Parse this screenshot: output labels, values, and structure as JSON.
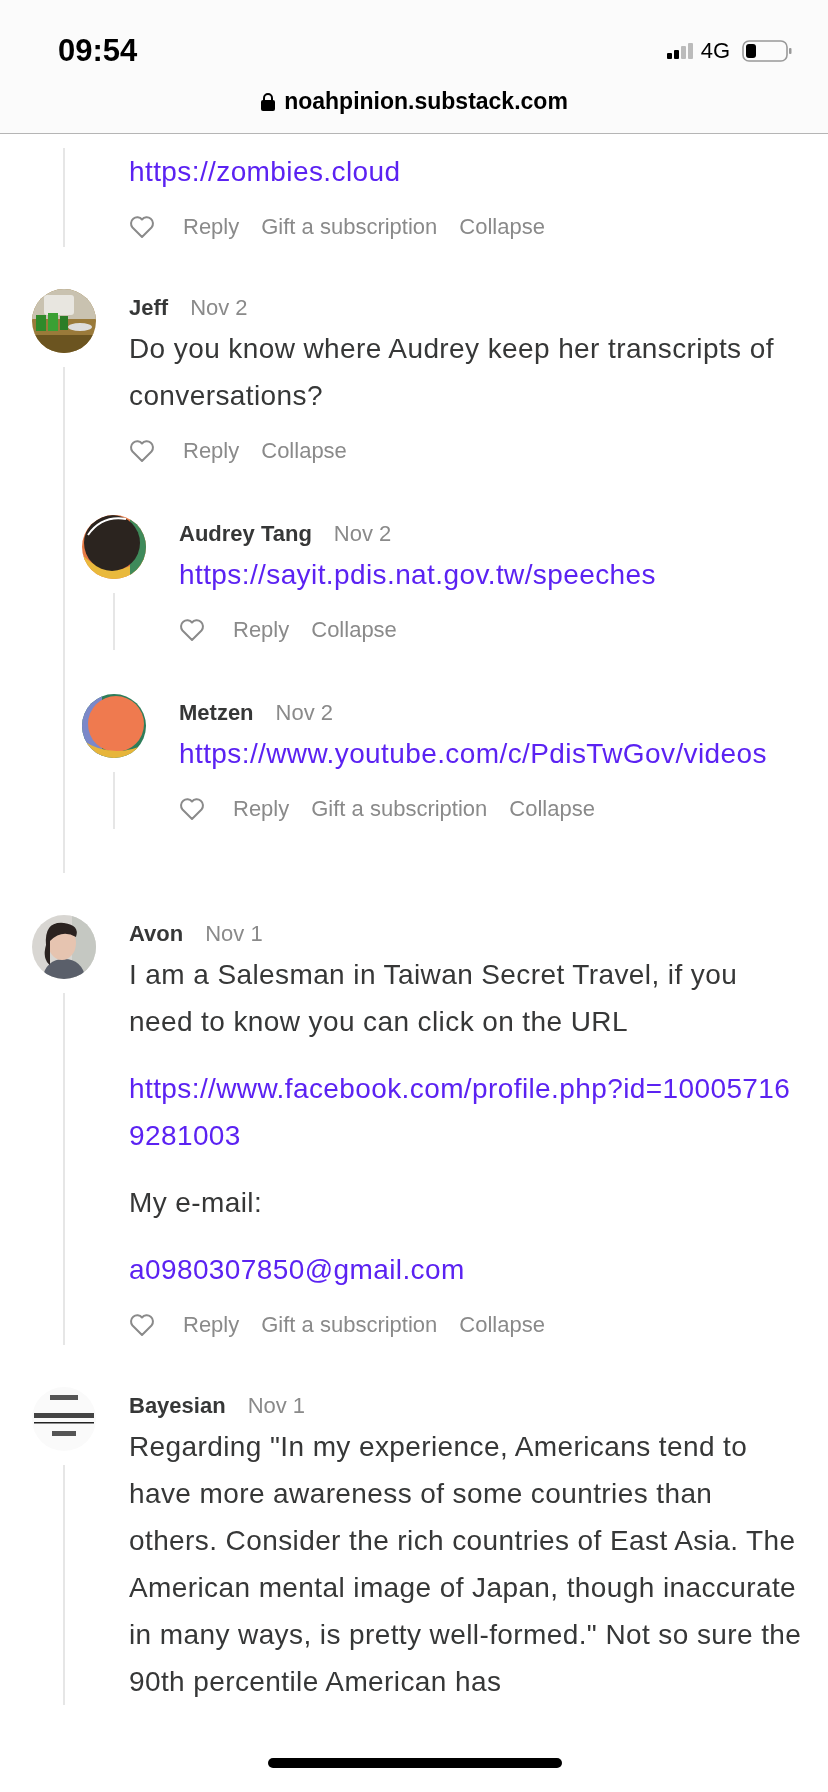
{
  "status_bar": {
    "time": "09:54",
    "network": "4G"
  },
  "address_bar": {
    "url": "noahpinion.substack.com"
  },
  "thread_fragment": {
    "body": [
      {
        "kind": "link",
        "text": "https://zombies.cloud"
      }
    ],
    "actions": [
      "Reply",
      "Gift a subscription",
      "Collapse"
    ]
  },
  "comments": [
    {
      "author": "Jeff",
      "date": "Nov 2",
      "avatar": {
        "kind": "picture"
      },
      "body": [
        {
          "kind": "text",
          "text": "Do you know where Audrey keep her transcripts of conversations?"
        }
      ],
      "actions": [
        "Reply",
        "Collapse"
      ],
      "children": [
        {
          "author": "Audrey Tang",
          "date": "Nov 2",
          "avatar": {
            "kind": "picture"
          },
          "body": [
            {
              "kind": "link",
              "text": "https://sayit.pdis.nat.gov.tw/speeches"
            }
          ],
          "actions": [
            "Reply",
            "Collapse"
          ]
        },
        {
          "author": "Metzen",
          "date": "Nov 2",
          "avatar": {
            "kind": "picture"
          },
          "body": [
            {
              "kind": "link",
              "text": "https://www.youtube.com/c/PdisTwGov/videos"
            }
          ],
          "actions": [
            "Reply",
            "Gift a subscription",
            "Collapse"
          ]
        }
      ]
    },
    {
      "author": "Avon",
      "date": "Nov 1",
      "avatar": {
        "kind": "picture"
      },
      "body": [
        {
          "kind": "text",
          "text": "I am a Salesman in Taiwan Secret Travel, if you need to know you can click on the URL"
        },
        {
          "kind": "link",
          "text": "https://www.facebook.com/profile.php?id=100057169281003"
        },
        {
          "kind": "text",
          "text": "My e-mail:"
        },
        {
          "kind": "link",
          "text": "a0980307850@gmail.com"
        }
      ],
      "actions": [
        "Reply",
        "Gift a subscription",
        "Collapse"
      ]
    },
    {
      "author": "Bayesian",
      "date": "Nov 1",
      "avatar": {
        "kind": "picture"
      },
      "body": [
        {
          "kind": "text",
          "text": "Regarding \"In my experience, Americans tend to have more awareness of some countries than others. Consider the rich countries of East Asia. The American mental image of Japan, though inaccurate in many ways, is pretty well-formed.\" Not so sure the 90th percentile American has"
        }
      ]
    }
  ]
}
